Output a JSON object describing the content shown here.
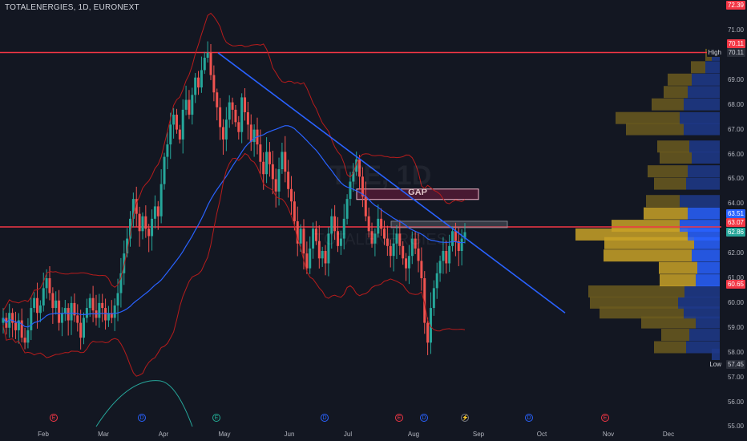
{
  "header": {
    "symbol": "TOTALENERGIES, 1D, EURONEXT"
  },
  "watermark": {
    "ticker": "TTE, 1D",
    "name": "TOTALENERGIES"
  },
  "annotations": {
    "gap": "GAP"
  },
  "price_axis": [
    "71.00",
    "70.11",
    "69.00",
    "68.00",
    "67.00",
    "66.00",
    "65.00",
    "64.00",
    "62.00",
    "61.00",
    "60.00",
    "59.00",
    "58.00",
    "57.00",
    "56.00",
    "55.00"
  ],
  "price_tags": {
    "top": "72.39",
    "red_top": "70.11",
    "high_label": "High",
    "high_value": "70.11",
    "ema": "63.51",
    "red_mid": "63.07",
    "last": "62.86",
    "red_low": "60.65",
    "low_label": "Low",
    "low_value": "57.45"
  },
  "months": [
    "Feb",
    "Mar",
    "Apr",
    "May",
    "Jun",
    "Jul",
    "Aug",
    "Sep",
    "Oct",
    "Nov",
    "Dec"
  ],
  "events": [
    {
      "t": "E",
      "color": "#f23645"
    },
    {
      "t": "D",
      "color": "#2962ff"
    },
    {
      "t": "E",
      "color": "#22ab94"
    },
    {
      "t": "D",
      "color": "#2962ff"
    },
    {
      "t": "E",
      "color": "#f23645"
    },
    {
      "t": "D",
      "color": "#2962ff"
    },
    {
      "t": "⚡",
      "color": "#787b86"
    },
    {
      "t": "D",
      "color": "#2962ff"
    },
    {
      "t": "E",
      "color": "#f23645"
    }
  ],
  "colors": {
    "up": "#26a69a",
    "down": "#ef5350",
    "bg": "#131722",
    "trend": "#2962ff",
    "hline": "#f23645"
  },
  "chart_data": {
    "type": "candlestick",
    "title": "TOTALENERGIES, 1D, EURONEXT",
    "ylim": [
      55,
      72.4
    ],
    "horizontal_lines": [
      70.11,
      63.07
    ],
    "candles_close_approx": [
      59.4,
      59.0,
      59.6,
      59.2,
      58.9,
      59.3,
      58.6,
      58.4,
      58.9,
      59.8,
      60.2,
      59.6,
      59.9,
      60.6,
      61.0,
      60.4,
      59.8,
      60.1,
      59.2,
      59.6,
      59.8,
      59.3,
      60.0,
      59.5,
      59.2,
      58.6,
      59.4,
      59.8,
      60.2,
      59.7,
      59.4,
      60.0,
      59.8,
      59.3,
      59.6,
      59.4,
      59.9,
      60.4,
      61.2,
      62.0,
      62.6,
      63.4,
      64.2,
      63.6,
      62.9,
      63.5,
      63.0,
      62.7,
      63.4,
      63.9,
      63.5,
      64.8,
      65.9,
      66.4,
      67.2,
      67.6,
      67.0,
      66.6,
      67.8,
      68.2,
      67.6,
      68.4,
      69.1,
      68.7,
      69.4,
      69.9,
      70.1,
      69.2,
      68.5,
      67.9,
      67.1,
      66.6,
      67.4,
      68.1,
      67.8,
      67.3,
      66.9,
      68.3,
      67.7,
      67.2,
      66.5,
      67.0,
      66.4,
      65.7,
      65.2,
      66.1,
      65.6,
      65.0,
      64.5,
      65.4,
      66.1,
      65.3,
      64.6,
      64.1,
      63.3,
      62.4,
      63.0,
      62.0,
      61.4,
      62.2,
      63.0,
      62.5,
      61.8,
      62.1,
      61.6,
      62.8,
      63.5,
      62.9,
      62.3,
      62.6,
      63.4,
      64.2,
      64.9,
      65.3,
      65.8,
      65.1,
      64.3,
      63.5,
      62.9,
      62.4,
      62.8,
      63.4,
      63.0,
      62.6,
      62.3,
      61.9,
      62.4,
      62.8,
      62.3,
      61.8,
      61.4,
      61.9,
      62.6,
      62.2,
      61.7,
      61.0,
      59.2,
      58.4,
      59.8,
      60.6,
      61.2,
      61.7,
      62.1,
      61.6,
      62.3,
      62.9,
      62.5,
      62.1,
      62.6,
      62.86
    ],
    "trendline": {
      "from": [
        70.1,
        "May"
      ],
      "to": [
        60.0,
        "Oct"
      ]
    },
    "gap_zone": [
      64.3,
      64.6
    ]
  }
}
